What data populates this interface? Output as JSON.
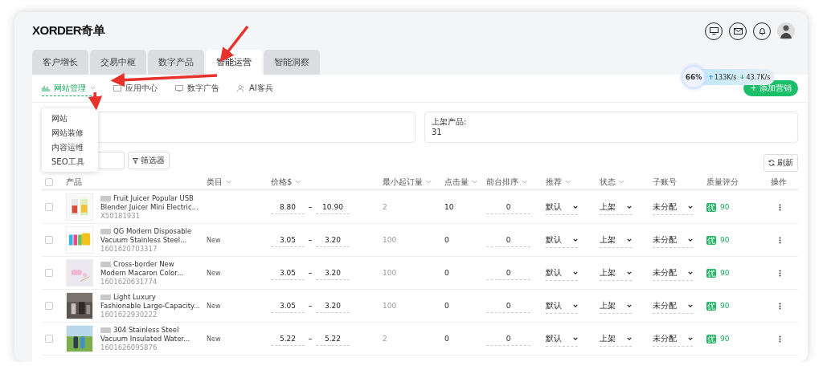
{
  "logo": {
    "brand": "XORDER",
    "name": "奇单"
  },
  "tabs": [
    {
      "label": "客户增长",
      "selected": false
    },
    {
      "label": "交易中枢",
      "selected": false
    },
    {
      "label": "数字产品",
      "selected": false
    },
    {
      "label": "智能运营",
      "selected": true
    },
    {
      "label": "智能洞察",
      "selected": false
    }
  ],
  "subnav": [
    {
      "label": "网站管理",
      "selected": true,
      "kind": "chart"
    },
    {
      "label": "应用中心",
      "selected": false,
      "kind": "app"
    },
    {
      "label": "数字广告",
      "selected": false,
      "kind": "ad"
    },
    {
      "label": "AI客兵",
      "selected": false,
      "kind": "people"
    }
  ],
  "dropdown": [
    "网站",
    "网站装修",
    "内容运维",
    "SEO工具"
  ],
  "add_button": "+ 添加营销",
  "speed_widget": {
    "percent": "66",
    "unit": "%",
    "up": "133K/s",
    "down": "43.7K/s"
  },
  "stats": {
    "label": "上架产品:",
    "value": "31"
  },
  "filter_button": "筛选器",
  "refresh_button": "刷新",
  "table": {
    "select_all": {
      "checked": false
    },
    "columns": [
      {
        "label": "产品",
        "sortable": false
      },
      {
        "label": "类目",
        "sortable": true
      },
      {
        "label": "价格$",
        "sortable": true
      },
      {
        "label": "最小起订量",
        "sortable": true
      },
      {
        "label": "点击量",
        "sortable": true
      },
      {
        "label": "前台排序",
        "sortable": true
      },
      {
        "label": "推荐",
        "sortable": true
      },
      {
        "label": "状态",
        "sortable": true
      },
      {
        "label": "子账号",
        "sortable": false
      },
      {
        "label": "质量评分",
        "sortable": false
      },
      {
        "label": "操作",
        "sortable": false
      }
    ],
    "rows": [
      {
        "checked": false,
        "title": [
          "Fruit Juicer Popular USB",
          "Blender Juicer Mini Electric..."
        ],
        "sku": "X50181931",
        "category": "",
        "price_min": "8.80",
        "price_max": "10.90",
        "moq": "2",
        "clicks": "10",
        "order": "0",
        "recommend": "默认",
        "status": "上架",
        "sub_account": "未分配",
        "grade": "优",
        "score": "90"
      },
      {
        "checked": false,
        "title": [
          "QG Modern Disposable",
          "Vacuum Stainless Steel..."
        ],
        "sku": "1601620703317",
        "category": "New",
        "price_min": "3.05",
        "price_max": "3.20",
        "moq": "100",
        "clicks": "0",
        "order": "0",
        "recommend": "默认",
        "status": "上架",
        "sub_account": "未分配",
        "grade": "优",
        "score": "90"
      },
      {
        "checked": false,
        "title": [
          "Cross-border New",
          "Modern Macaron Color..."
        ],
        "sku": "1601620631774",
        "category": "New",
        "price_min": "3.05",
        "price_max": "3.20",
        "moq": "100",
        "clicks": "0",
        "order": "0",
        "recommend": "默认",
        "status": "上架",
        "sub_account": "未分配",
        "grade": "优",
        "score": "90"
      },
      {
        "checked": false,
        "title": [
          "Light Luxury",
          "Fashionable Large-Capacity..."
        ],
        "sku": "1601622930222",
        "category": "New",
        "price_min": "3.05",
        "price_max": "3.20",
        "moq": "100",
        "clicks": "0",
        "order": "0",
        "recommend": "默认",
        "status": "上架",
        "sub_account": "未分配",
        "grade": "优",
        "score": "90"
      },
      {
        "checked": false,
        "title": [
          "304 Stainless Steel",
          "Vacuum Insulated Water..."
        ],
        "sku": "1601626095876",
        "category": "New",
        "price_min": "5.22",
        "price_max": "5.22",
        "moq": "2",
        "clicks": "0",
        "order": "0",
        "recommend": "默认",
        "status": "上架",
        "sub_account": "未分配",
        "grade": "优",
        "score": "90"
      }
    ]
  }
}
